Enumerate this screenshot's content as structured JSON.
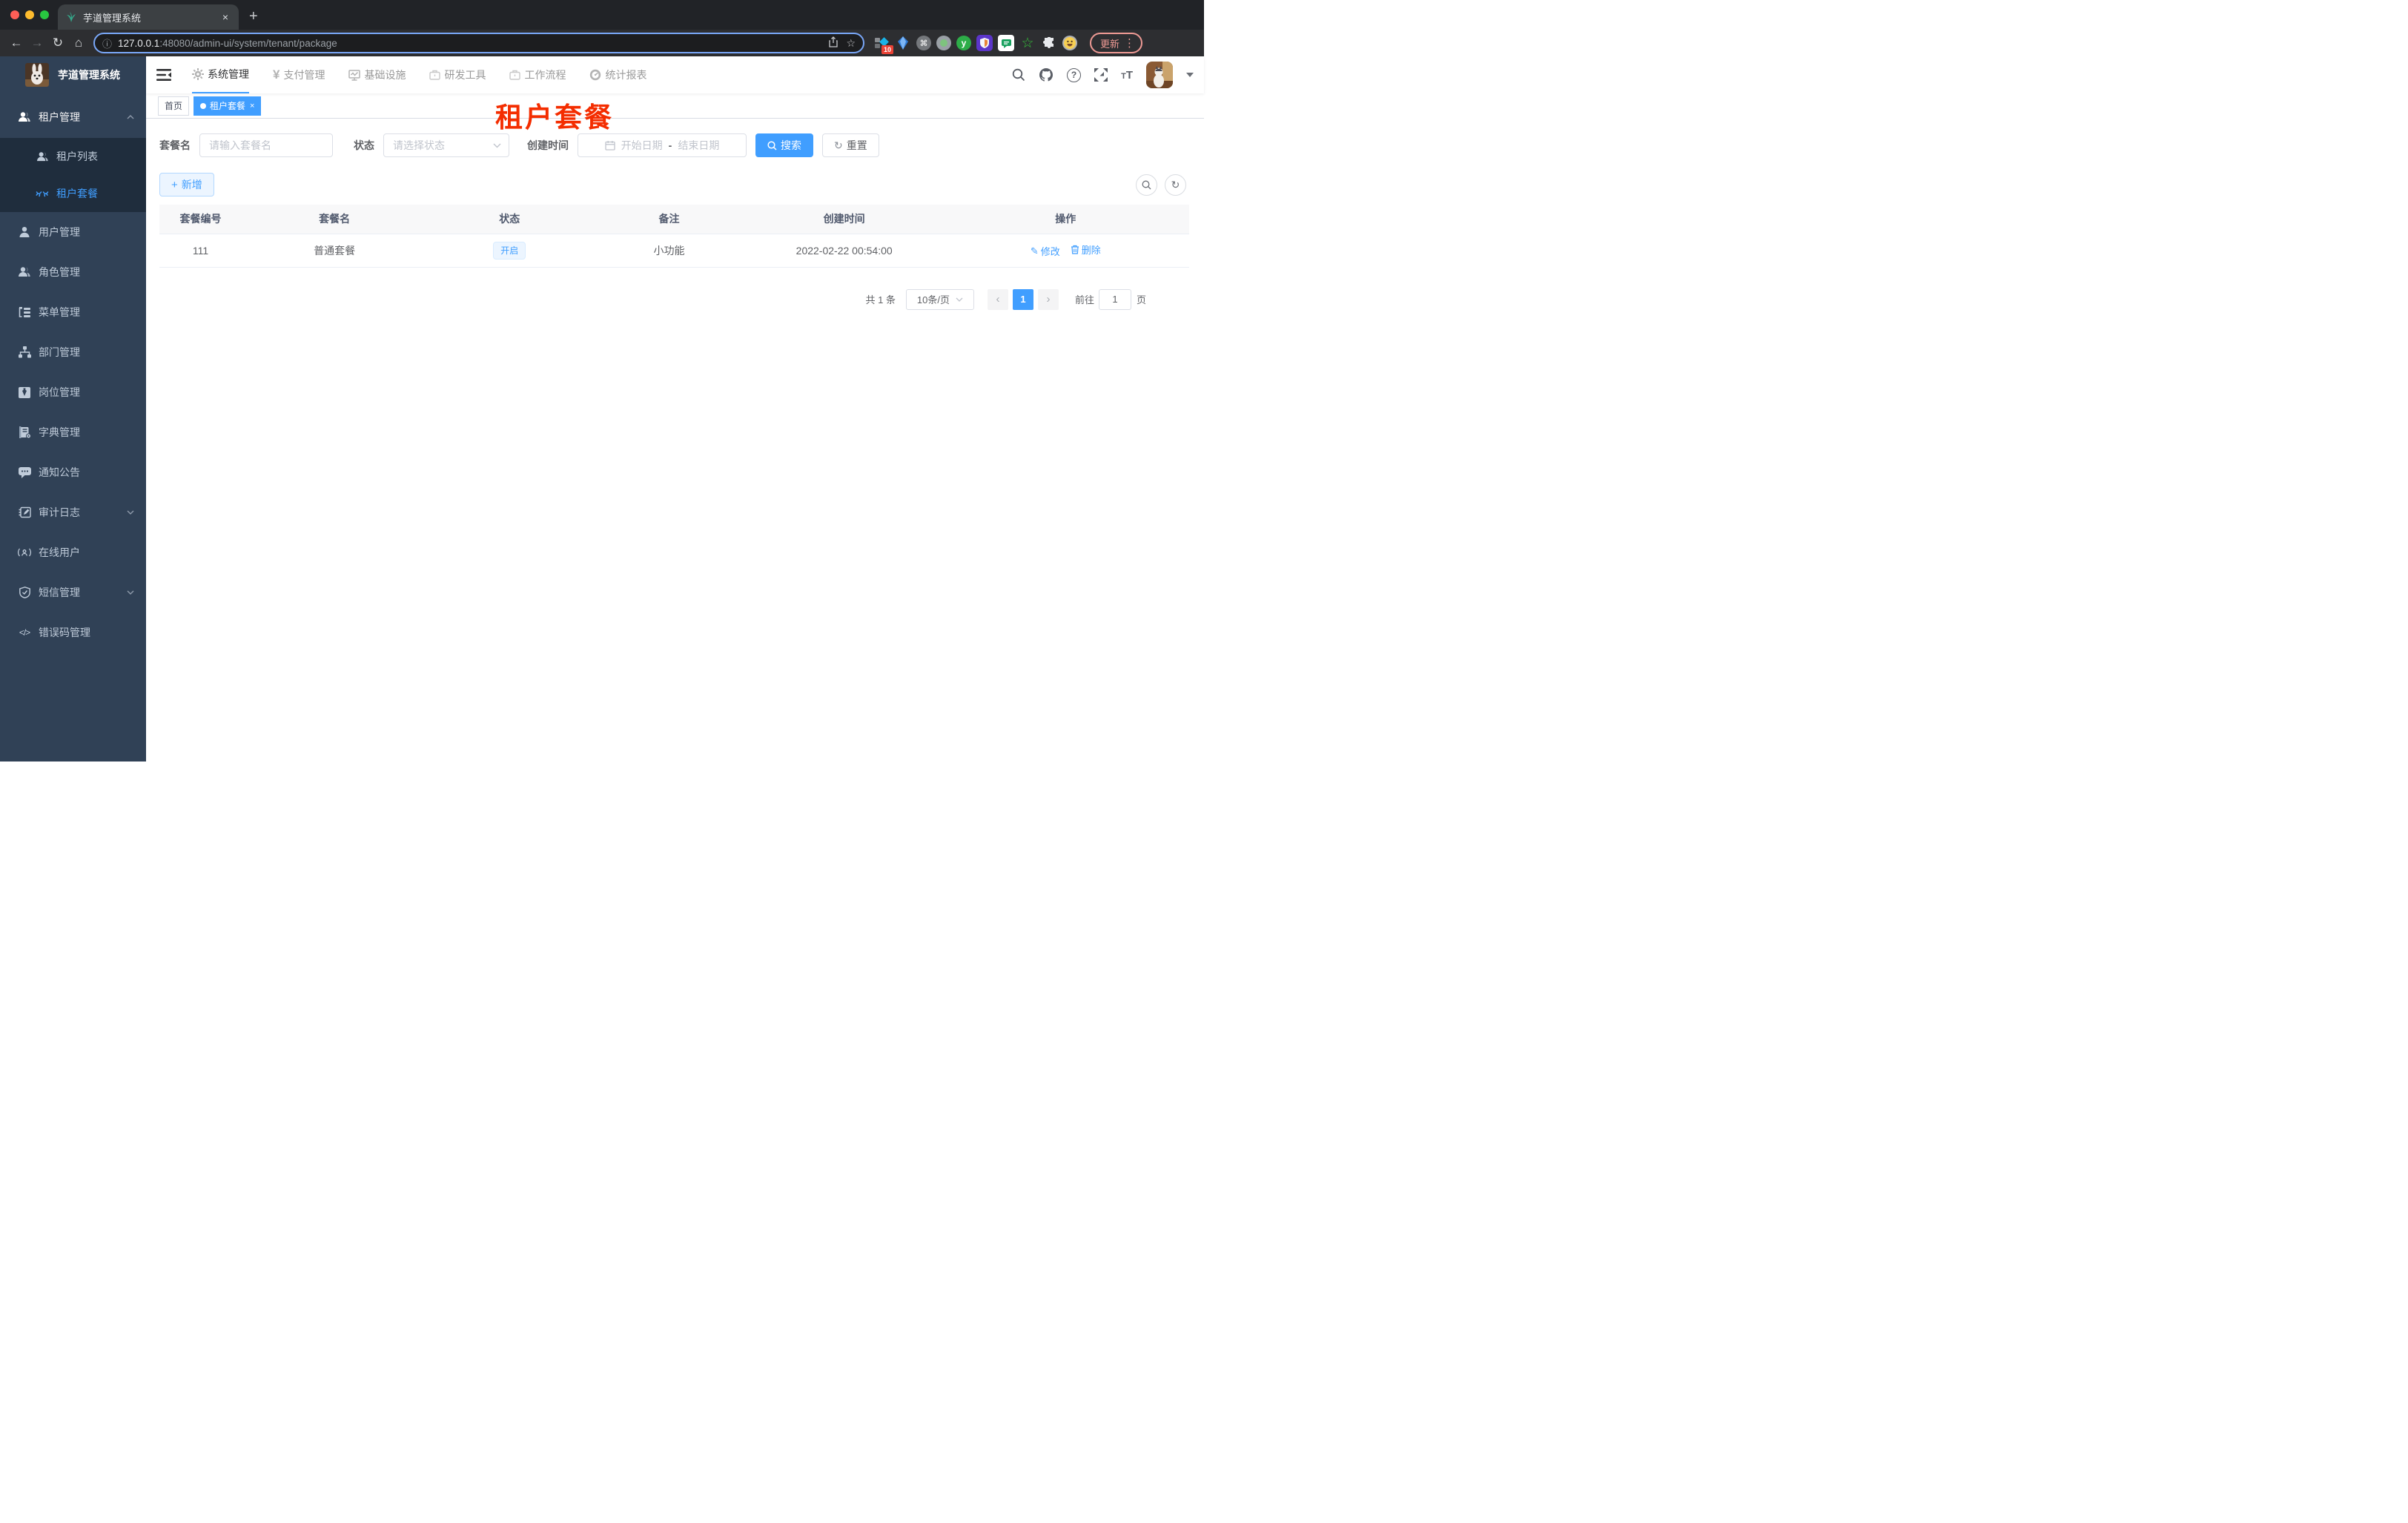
{
  "colors": {
    "accent": "#409eff",
    "annotation_red": "#f42d00",
    "sidebar_bg": "#304156",
    "submenu_bg": "#1f2d3d",
    "tag_light_bg": "#ecf5ff"
  },
  "browser": {
    "tab_title": "芋道管理系统",
    "tab_close": "×",
    "new_tab": "+",
    "back": "←",
    "forward": "→",
    "reload": "↻",
    "home": "⌂",
    "site_info": "ⓘ",
    "url_host": "127.0.0.1",
    "url_path": ":48080/admin-ui/system/tenant/package",
    "bookmark_star": "☆",
    "ext_badge": "10",
    "ext_cmd": "⌘",
    "ext_y": "y",
    "ext_star": "☆",
    "update_label": "更新",
    "menu_dots": "⋮"
  },
  "sidebar": {
    "app_title": "芋道管理系统",
    "items": [
      {
        "label": "租户管理"
      },
      {
        "label": "租户列表"
      },
      {
        "label": "租户套餐"
      },
      {
        "label": "用户管理"
      },
      {
        "label": "角色管理"
      },
      {
        "label": "菜单管理"
      },
      {
        "label": "部门管理"
      },
      {
        "label": "岗位管理"
      },
      {
        "label": "字典管理"
      },
      {
        "label": "通知公告"
      },
      {
        "label": "审计日志"
      },
      {
        "label": "在线用户"
      },
      {
        "label": "短信管理"
      },
      {
        "label": "错误码管理"
      }
    ]
  },
  "header": {
    "nav": [
      {
        "label": "系统管理"
      },
      {
        "label": "支付管理"
      },
      {
        "label": "基础设施"
      },
      {
        "label": "研发工具"
      },
      {
        "label": "工作流程"
      },
      {
        "label": "统计报表"
      }
    ],
    "yen": "¥",
    "help": "?",
    "font_size_icon": "T"
  },
  "tags": {
    "home": "首页",
    "active": "租户套餐",
    "close": "×"
  },
  "annotation": "租户套餐",
  "filters": {
    "name_label": "套餐名",
    "name_placeholder": "请输入套餐名",
    "status_label": "状态",
    "status_placeholder": "请选择状态",
    "created_label": "创建时间",
    "start_placeholder": "开始日期",
    "range_sep": "-",
    "end_placeholder": "结束日期",
    "search_label": "搜索",
    "reset_label": "重置",
    "reset_icon": "↻"
  },
  "toolbar": {
    "add_label": "新增",
    "plus": "+",
    "refresh_icon": "↻"
  },
  "table": {
    "headers": [
      "套餐编号",
      "套餐名",
      "状态",
      "备注",
      "创建时间",
      "操作"
    ],
    "rows": [
      {
        "id": "111",
        "name": "普通套餐",
        "status": "开启",
        "remark": "小功能",
        "created": "2022-02-22 00:54:00"
      }
    ],
    "actions": {
      "edit": "修改",
      "edit_icon": "✎",
      "delete": "删除"
    }
  },
  "pagination": {
    "total": "共 1 条",
    "page_size": "10条/页",
    "prev": "‹",
    "page": "1",
    "next": "›",
    "goto_label": "前往",
    "goto_value": "1",
    "unit_label": "页"
  }
}
